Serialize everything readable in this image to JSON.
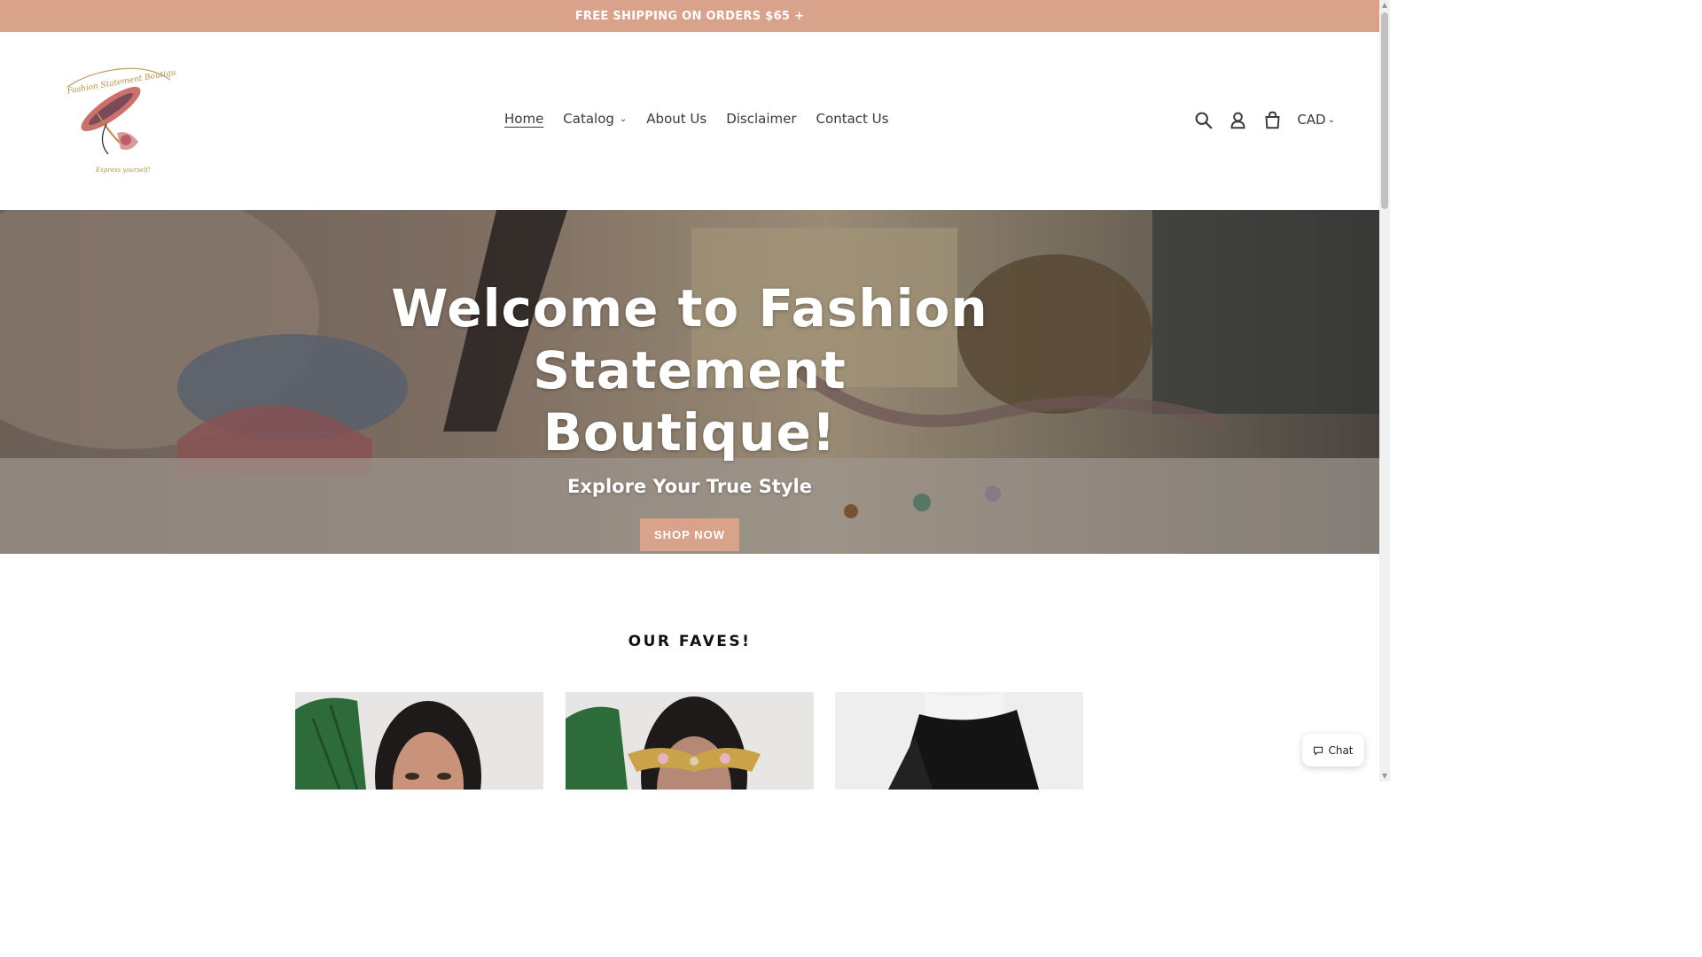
{
  "announcement": {
    "text": "FREE SHIPPING ON ORDERS $65 +"
  },
  "header": {
    "logo_text_top": "Fashion Statement Boutique",
    "logo_text_bottom": "Express yourself!",
    "nav": [
      {
        "label": "Home",
        "active": true
      },
      {
        "label": "Catalog",
        "has_dropdown": true
      },
      {
        "label": "About Us"
      },
      {
        "label": "Disclaimer"
      },
      {
        "label": "Contact Us"
      }
    ],
    "icons": [
      "search-icon",
      "account-icon",
      "cart-icon"
    ],
    "currency": "CAD"
  },
  "hero": {
    "title": "Welcome to Fashion Statement Boutique!",
    "subtitle": "Explore Your True Style",
    "button_label": "SHOP NOW"
  },
  "faves": {
    "title": "OUR FAVES!",
    "products": [
      {
        "name": "product-wig-model"
      },
      {
        "name": "product-jeweled-mask"
      },
      {
        "name": "product-black-top"
      }
    ]
  },
  "chat": {
    "label": "Chat"
  },
  "colors": {
    "accent": "#d8a38a",
    "text": "#3a3a3a"
  }
}
